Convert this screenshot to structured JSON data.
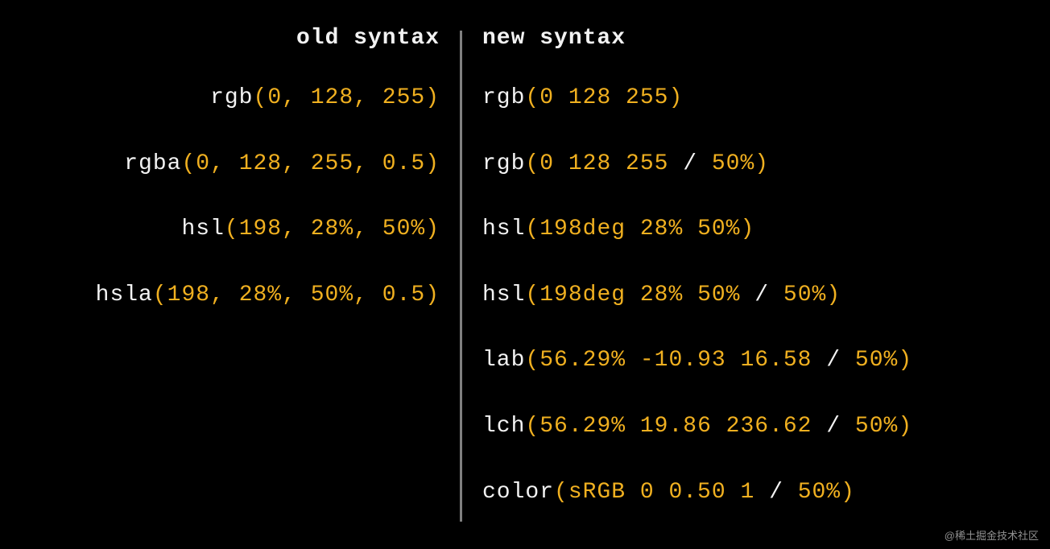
{
  "headings": {
    "old": "old syntax",
    "new": "new syntax"
  },
  "old_rows": [
    {
      "fn": "rgb",
      "tokens": [
        {
          "t": "val",
          "v": "0"
        },
        {
          "t": "sep",
          "v": ", "
        },
        {
          "t": "val",
          "v": "128"
        },
        {
          "t": "sep",
          "v": ", "
        },
        {
          "t": "val",
          "v": "255"
        }
      ]
    },
    {
      "fn": "rgba",
      "tokens": [
        {
          "t": "val",
          "v": "0"
        },
        {
          "t": "sep",
          "v": ", "
        },
        {
          "t": "val",
          "v": "128"
        },
        {
          "t": "sep",
          "v": ", "
        },
        {
          "t": "val",
          "v": "255"
        },
        {
          "t": "sep",
          "v": ", "
        },
        {
          "t": "val",
          "v": "0.5"
        }
      ]
    },
    {
      "fn": "hsl",
      "tokens": [
        {
          "t": "val",
          "v": "198"
        },
        {
          "t": "sep",
          "v": ", "
        },
        {
          "t": "val",
          "v": "28%"
        },
        {
          "t": "sep",
          "v": ", "
        },
        {
          "t": "val",
          "v": "50%"
        }
      ]
    },
    {
      "fn": "hsla",
      "tokens": [
        {
          "t": "val",
          "v": "198"
        },
        {
          "t": "sep",
          "v": ", "
        },
        {
          "t": "val",
          "v": "28%"
        },
        {
          "t": "sep",
          "v": ", "
        },
        {
          "t": "val",
          "v": "50%"
        },
        {
          "t": "sep",
          "v": ", "
        },
        {
          "t": "val",
          "v": "0.5"
        }
      ]
    }
  ],
  "new_rows": [
    {
      "fn": "rgb",
      "tokens": [
        {
          "t": "val",
          "v": "0 128 255"
        }
      ]
    },
    {
      "fn": "rgb",
      "tokens": [
        {
          "t": "val",
          "v": "0 128 255 "
        },
        {
          "t": "op",
          "v": "/"
        },
        {
          "t": "val",
          "v": " 50%"
        }
      ]
    },
    {
      "fn": "hsl",
      "tokens": [
        {
          "t": "val",
          "v": "198deg 28% 50%"
        }
      ]
    },
    {
      "fn": "hsl",
      "tokens": [
        {
          "t": "val",
          "v": "198deg 28% 50% "
        },
        {
          "t": "op",
          "v": "/"
        },
        {
          "t": "val",
          "v": " 50%"
        }
      ]
    },
    {
      "fn": "lab",
      "tokens": [
        {
          "t": "val",
          "v": "56.29% -10.93 16.58 "
        },
        {
          "t": "op",
          "v": "/"
        },
        {
          "t": "val",
          "v": " 50%"
        }
      ]
    },
    {
      "fn": "lch",
      "tokens": [
        {
          "t": "val",
          "v": "56.29% 19.86 236.62 "
        },
        {
          "t": "op",
          "v": "/"
        },
        {
          "t": "val",
          "v": " 50%"
        }
      ]
    },
    {
      "fn": "color",
      "tokens": [
        {
          "t": "val",
          "v": "sRGB 0 0.50 1 "
        },
        {
          "t": "op",
          "v": "/"
        },
        {
          "t": "val",
          "v": " 50%"
        }
      ]
    }
  ],
  "watermark": "@稀土掘金技术社区"
}
